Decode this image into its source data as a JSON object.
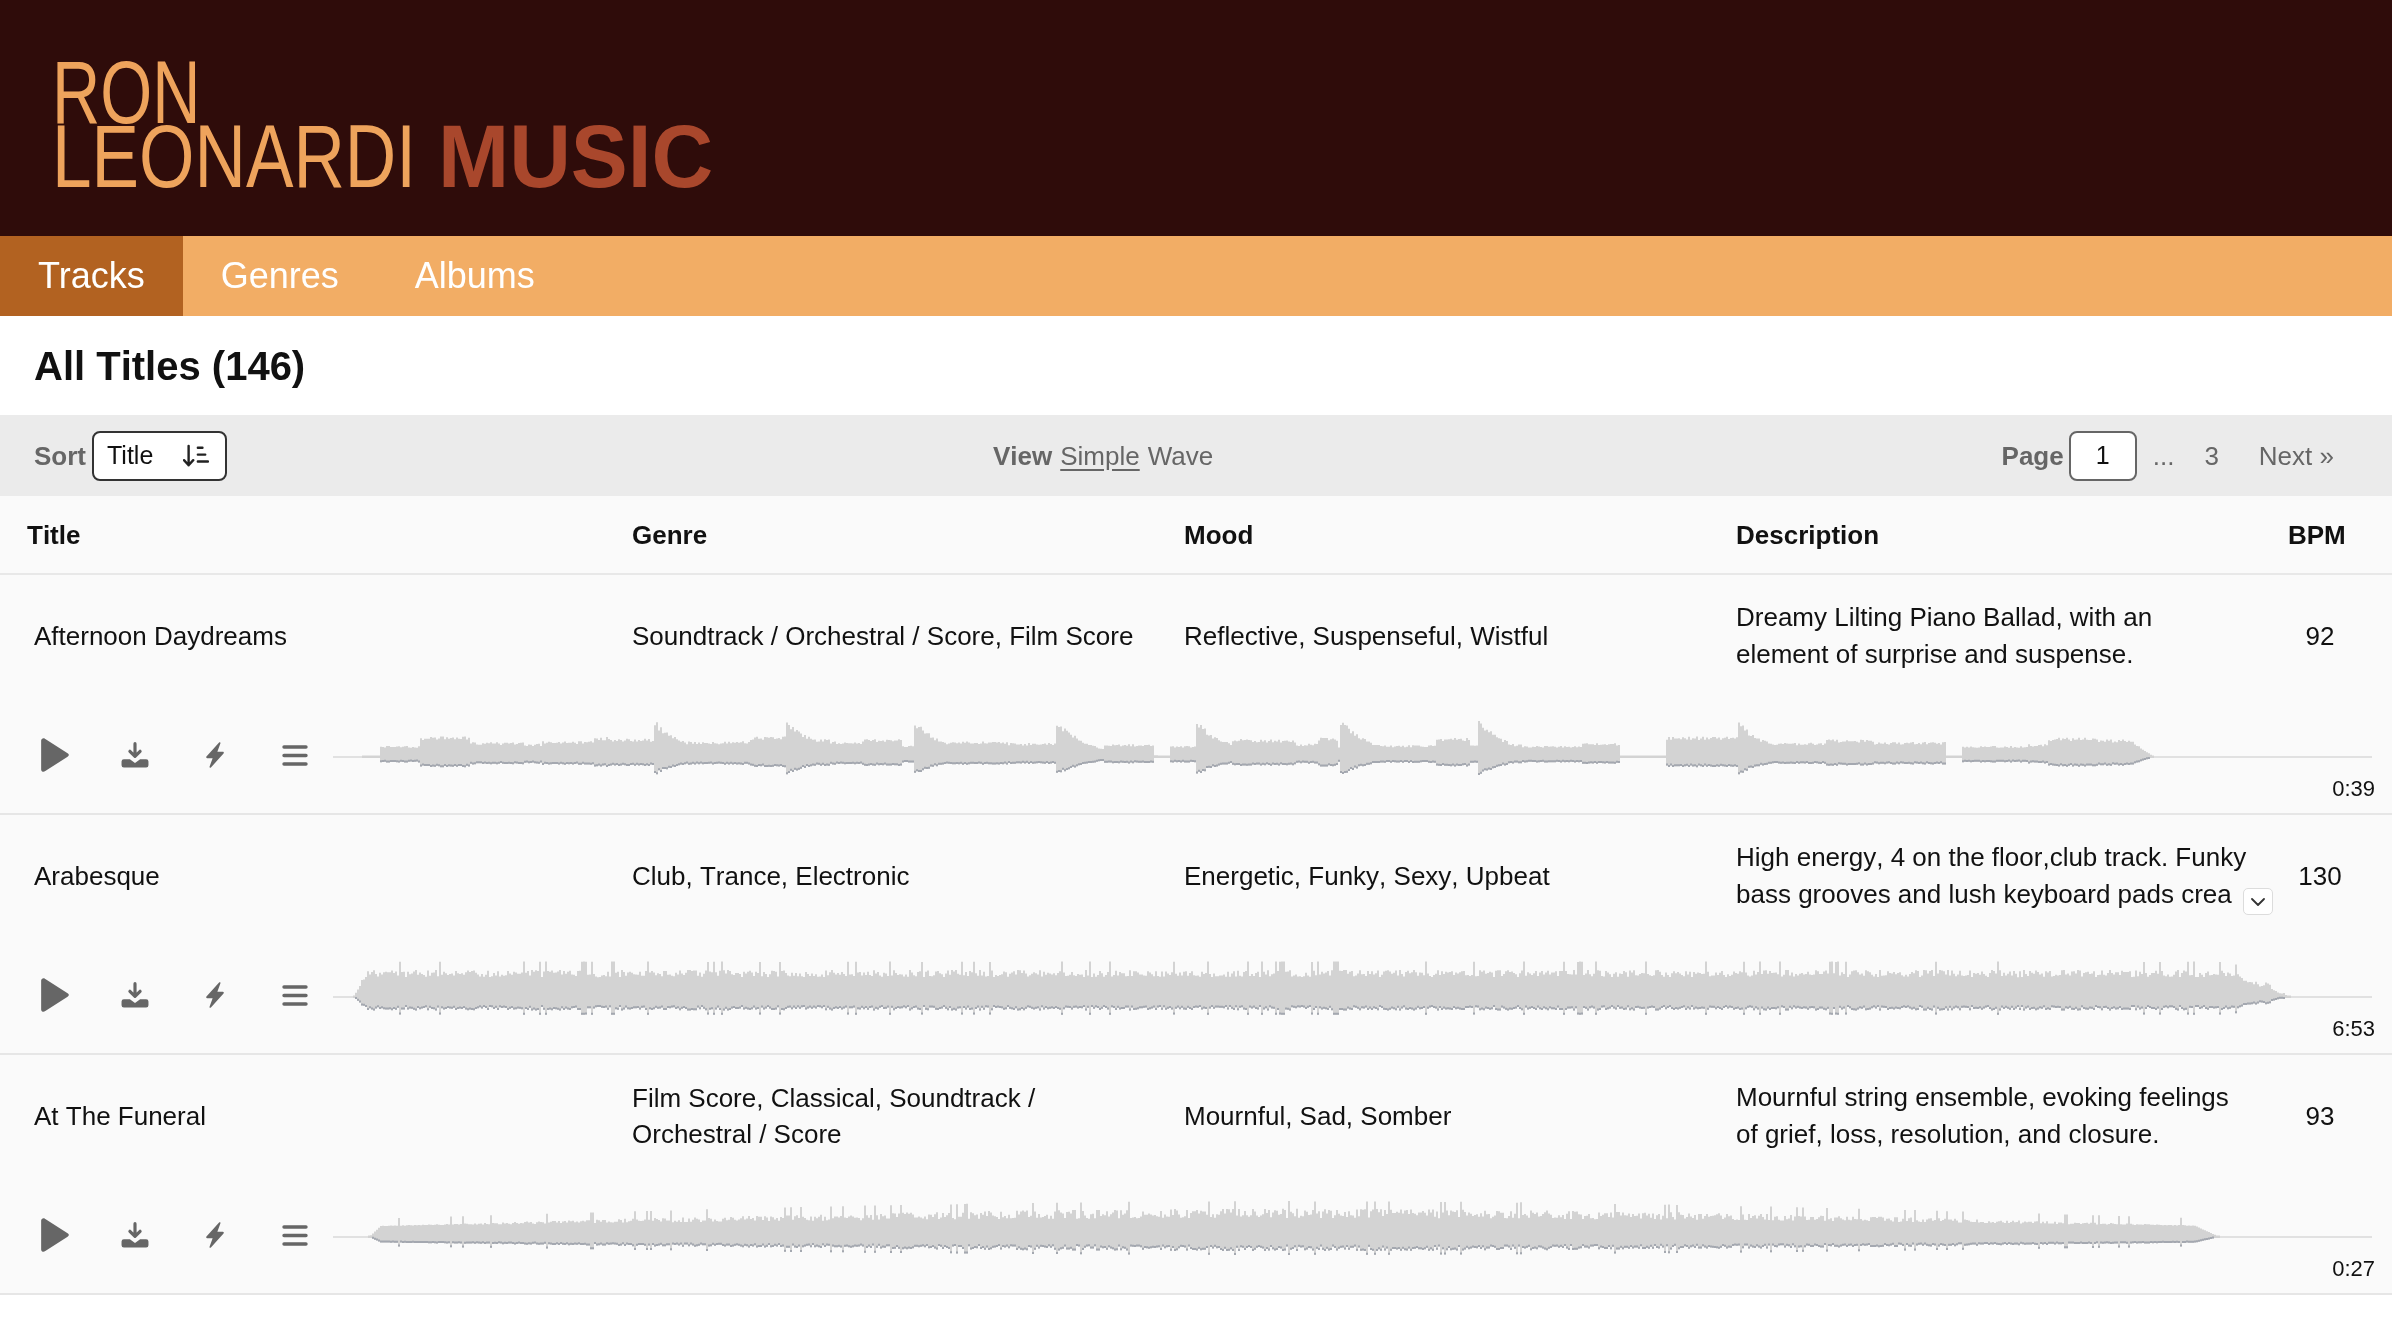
{
  "header": {
    "logo": {
      "line_1": "RON",
      "line_2": "LEONARDI",
      "accent": "MUSIC"
    }
  },
  "nav": [
    {
      "label": "Tracks",
      "selected": true
    },
    {
      "label": "Genres",
      "selected": false
    },
    {
      "label": "Albums",
      "selected": false
    }
  ],
  "heading": "All Titles (146)",
  "toolbar": {
    "sort": {
      "label": "Sort",
      "value": "Title"
    },
    "view": {
      "label": "View",
      "options": [
        {
          "label": "Simple",
          "selected": false
        },
        {
          "label": "Wave",
          "selected": true
        }
      ]
    },
    "pagination": {
      "label": "Page",
      "value": "1",
      "ellipsis": "...",
      "pages": [
        "3"
      ],
      "next": "Next »"
    }
  },
  "table": {
    "columns": [
      "Title",
      "Genre",
      "Mood",
      "Description",
      "BPM"
    ],
    "rows": [
      {
        "title": "Afternoon Daydreams",
        "genre": "Soundtrack / Orchestral / Score, Film Score",
        "mood": "Reflective, Suspenseful, Wistful",
        "description": "Dreamy Lilting Piano Ballad, with an element of surprise and suspense.",
        "bpm": "92",
        "duration": "0:39",
        "truncated": false
      },
      {
        "title": "Arabesque",
        "genre": "Club, Trance, Electronic",
        "mood": "Energetic, Funky, Sexy, Upbeat",
        "description": "High energy, 4 on the floor,club track. Funky bass grooves and lush keyboard pads crea",
        "bpm": "130",
        "duration": "6:53",
        "truncated": true
      },
      {
        "title": "At The Funeral",
        "genre": "Film Score, Classical, Soundtrack / Orchestral / Score",
        "mood": "Mournful, Sad, Somber",
        "description": "Mournful string ensemble, evoking feelings of grief, loss, resolution, and closure.",
        "bpm": "93",
        "duration": "0:27",
        "truncated": false
      }
    ]
  }
}
